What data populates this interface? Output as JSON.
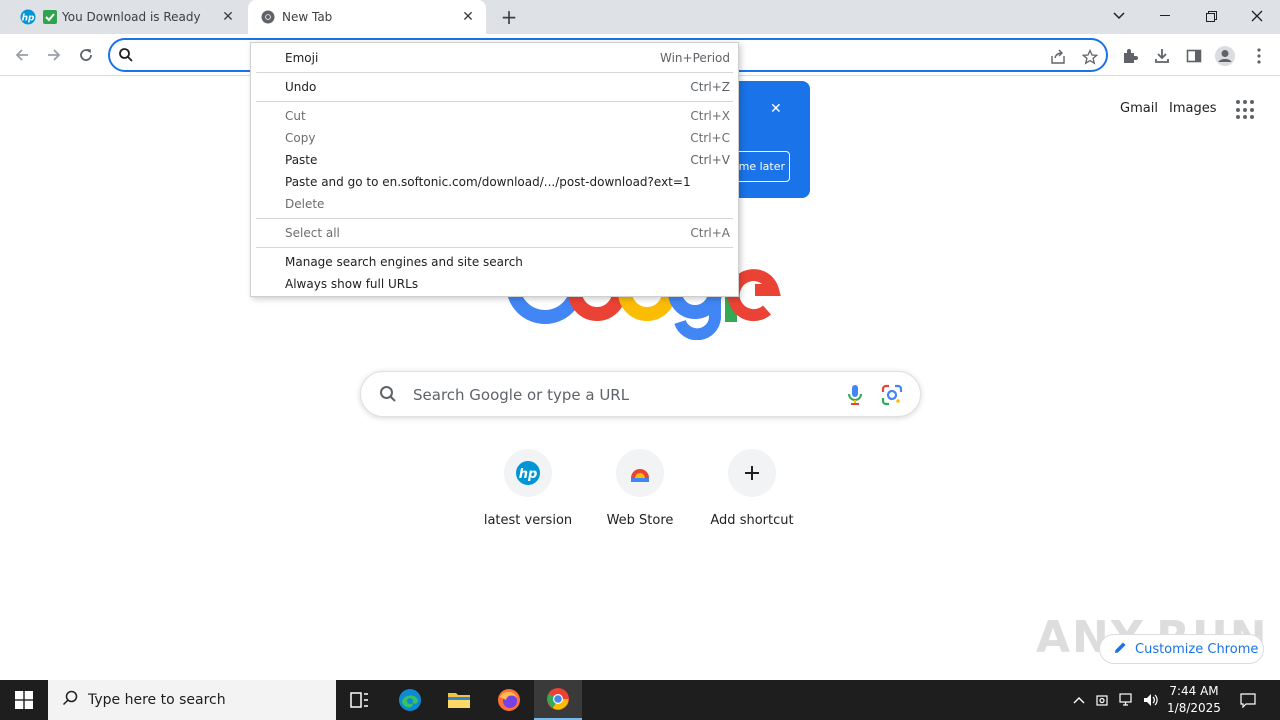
{
  "tabs": [
    {
      "title": "You Download is Ready",
      "favicon": "hp-icon"
    },
    {
      "title": "New Tab",
      "favicon": "chrome-icon"
    }
  ],
  "omnibox": {
    "value": ""
  },
  "google": {
    "links": [
      "Gmail",
      "Images"
    ],
    "search_placeholder": "Search Google or type a URL",
    "shortcuts": [
      {
        "label": "latest version",
        "icon": "hp-icon"
      },
      {
        "label": "Web Store",
        "icon": "webstore-icon"
      },
      {
        "label": "Add shortcut",
        "icon": "plus-icon"
      }
    ],
    "customize_label": "Customize Chrome",
    "promo_button": "me later"
  },
  "watermark": "ANY.RUN",
  "context_menu": {
    "items": [
      {
        "label": "Emoji",
        "shortcut": "Win+Period",
        "enabled": true
      },
      {
        "label": "Undo",
        "shortcut": "Ctrl+Z",
        "enabled": true
      },
      {
        "label": "Cut",
        "shortcut": "Ctrl+X",
        "enabled": false
      },
      {
        "label": "Copy",
        "shortcut": "Ctrl+C",
        "enabled": false
      },
      {
        "label": "Paste",
        "shortcut": "Ctrl+V",
        "enabled": true
      },
      {
        "label": "Paste and go to en.softonic.com/download/.../post-download?ext=1",
        "shortcut": "",
        "enabled": true
      },
      {
        "label": "Delete",
        "shortcut": "",
        "enabled": false
      },
      {
        "label": "Select all",
        "shortcut": "Ctrl+A",
        "enabled": false
      },
      {
        "label": "Manage search engines and site search",
        "shortcut": "",
        "enabled": true
      },
      {
        "label": "Always show full URLs",
        "shortcut": "",
        "enabled": true
      }
    ]
  },
  "taskbar": {
    "search_placeholder": "Type here to search",
    "time": "7:44 AM",
    "date": "1/8/2025"
  },
  "colors": {
    "accent": "#1a73e8",
    "tabstrip": "#dee1e6",
    "taskbar": "#1e1e1e"
  }
}
